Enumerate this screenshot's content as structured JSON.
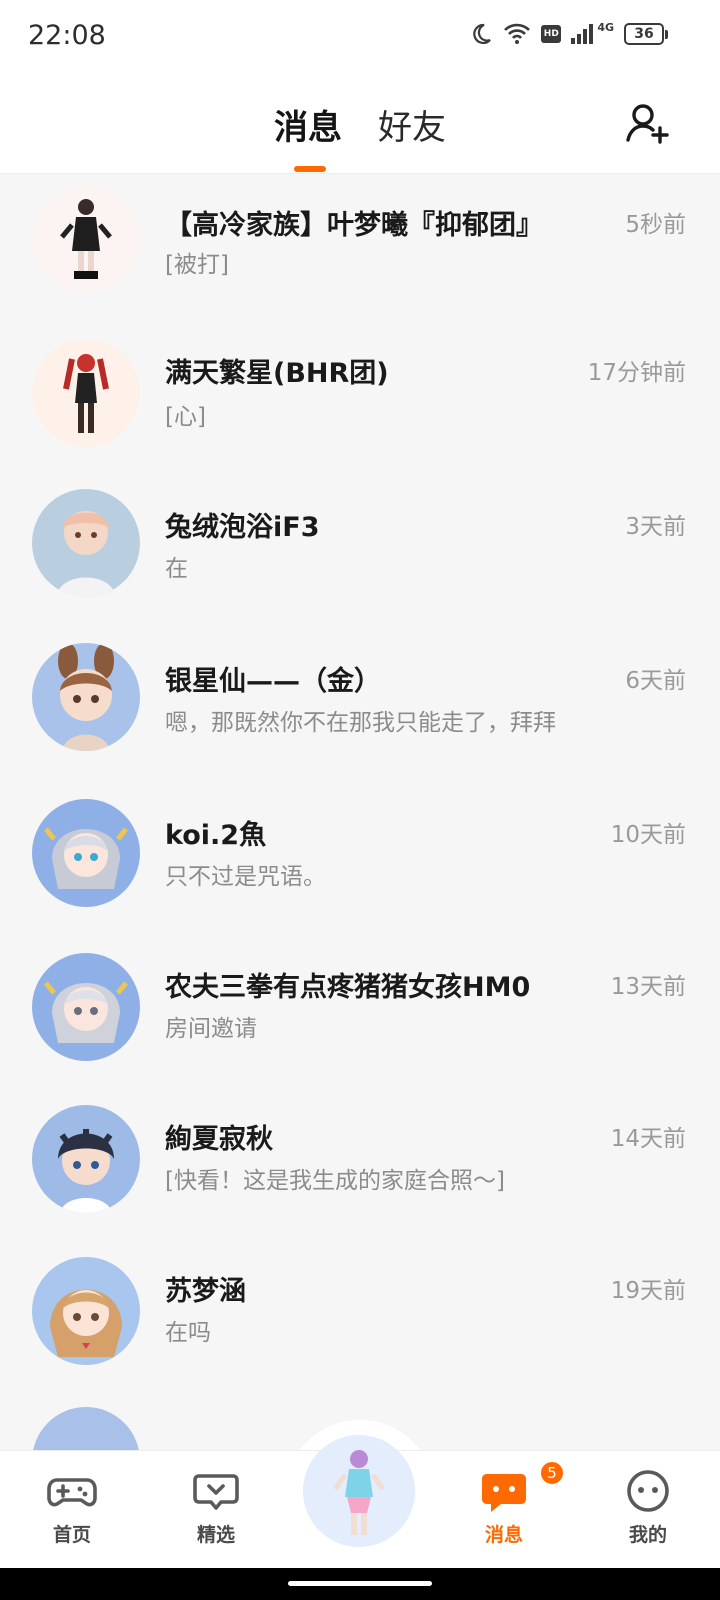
{
  "status_bar": {
    "time": "22:08",
    "network_label": "4G",
    "hd_label": "HD",
    "battery": "36",
    "icons": [
      "moon-icon",
      "wifi-icon",
      "hd-icon",
      "signal-icon",
      "battery-icon"
    ]
  },
  "header": {
    "tabs": [
      {
        "label": "消息",
        "active": true
      },
      {
        "label": "好友",
        "active": false
      }
    ],
    "add_friend_icon": "add-friend-icon"
  },
  "conversations": [
    {
      "name": "【高冷家族】叶梦曦『抑郁团』",
      "preview": "[被打]",
      "time": "5秒前"
    },
    {
      "name": "满天繁星(BHR团)",
      "preview": "[心]",
      "time": "17分钟前"
    },
    {
      "name": "兔绒泡浴iF3",
      "preview": "在",
      "time": "3天前"
    },
    {
      "name": "银星仙——（金）",
      "preview": "嗯，那既然你不在那我只能走了，拜拜",
      "time": "6天前"
    },
    {
      "name": "koi.2魚",
      "preview": "只不过是咒语。",
      "time": "10天前"
    },
    {
      "name": "农夫三拳有点疼猪猪女孩HM0",
      "preview": "房间邀请",
      "time": "13天前"
    },
    {
      "name": "絢夏寂秋",
      "preview": "[快看！这是我生成的家庭合照～]",
      "time": "14天前"
    },
    {
      "name": "苏梦涵",
      "preview": "在吗",
      "time": "19天前"
    }
  ],
  "bottom_nav": {
    "home": {
      "label": "首页",
      "icon": "gamepad-icon"
    },
    "featured": {
      "label": "精选",
      "icon": "heart-chat-icon"
    },
    "center": {
      "icon": "avatar-character"
    },
    "messages": {
      "label": "消息",
      "icon": "message-icon",
      "badge": "5",
      "active": true
    },
    "me": {
      "label": "我的",
      "icon": "face-icon"
    }
  },
  "colors": {
    "accent": "#ff6a00",
    "text_primary": "#1a1a1a",
    "text_secondary": "#8c8c8c",
    "background": "#f7f6f7"
  }
}
